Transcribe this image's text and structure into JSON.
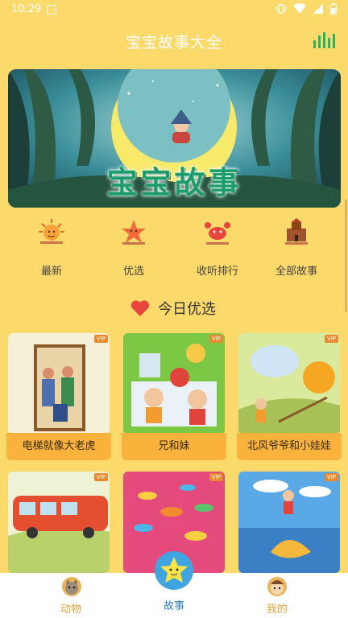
{
  "status": {
    "time": "10:29"
  },
  "appbar": {
    "title": "宝宝故事大全"
  },
  "banner": {
    "text": "宝宝故事"
  },
  "quick_links": [
    {
      "label": "最新",
      "icon": "sun-icon"
    },
    {
      "label": "优选",
      "icon": "starfish-icon"
    },
    {
      "label": "收听排行",
      "icon": "crab-icon"
    },
    {
      "label": "全部故事",
      "icon": "sandcastle-icon"
    }
  ],
  "section": {
    "title": "今日优选",
    "icon": "heart-icon"
  },
  "cards": [
    {
      "title": "电梯就像大老虎",
      "badge": "VIP"
    },
    {
      "title": "兄和妹",
      "badge": "VIP"
    },
    {
      "title": "北风爷爷和小娃娃",
      "badge": "VIP"
    },
    {
      "title": "",
      "badge": "VIP"
    },
    {
      "title": "",
      "badge": "VIP"
    },
    {
      "title": "",
      "badge": "VIP"
    }
  ],
  "tabbar": {
    "items": [
      {
        "label": "动物",
        "icon": "cat-icon"
      },
      {
        "label": "故事",
        "icon": "star-icon"
      },
      {
        "label": "我的",
        "icon": "baby-face-icon"
      }
    ]
  },
  "colors": {
    "background": "#fbd96b",
    "caption": "#f9b33d",
    "accent": "#e2a23a",
    "vip": "#e98a2f"
  }
}
